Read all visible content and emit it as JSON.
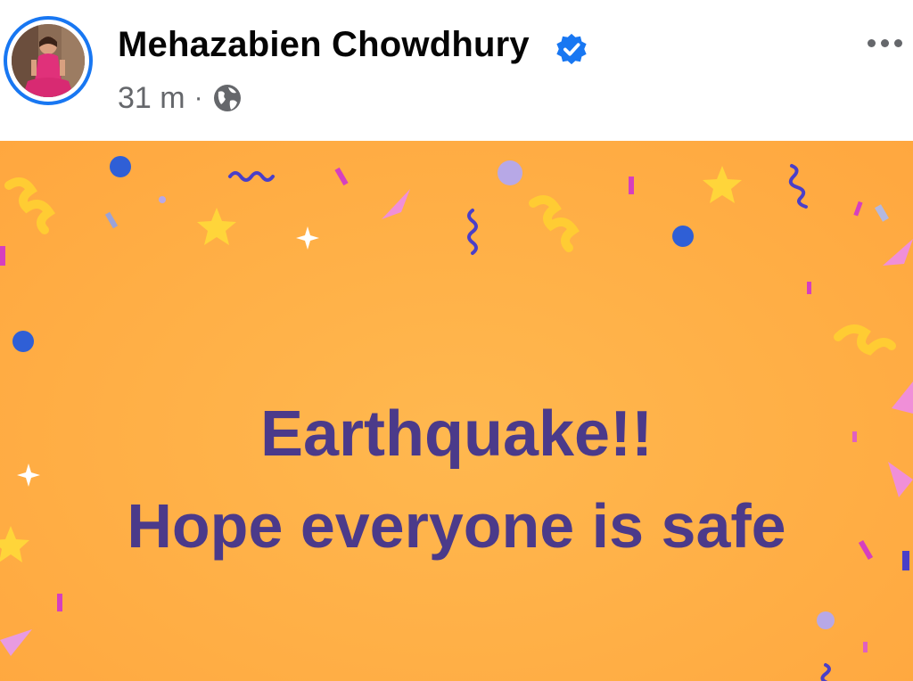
{
  "post": {
    "author_name": "Mehazabien Chowdhury",
    "verified_icon": "verified-badge-icon",
    "time_ago": "31 m",
    "separator": "·",
    "audience_icon": "globe-icon",
    "more_icon": "more-options-icon"
  },
  "banner": {
    "line1": "Earthquake!!",
    "line2": "Hope everyone is safe",
    "background_color": "#ffae45",
    "text_color": "#4b3a8a"
  },
  "colors": {
    "brand_blue": "#1877f2",
    "text_primary": "#050505",
    "text_secondary": "#65676b"
  }
}
